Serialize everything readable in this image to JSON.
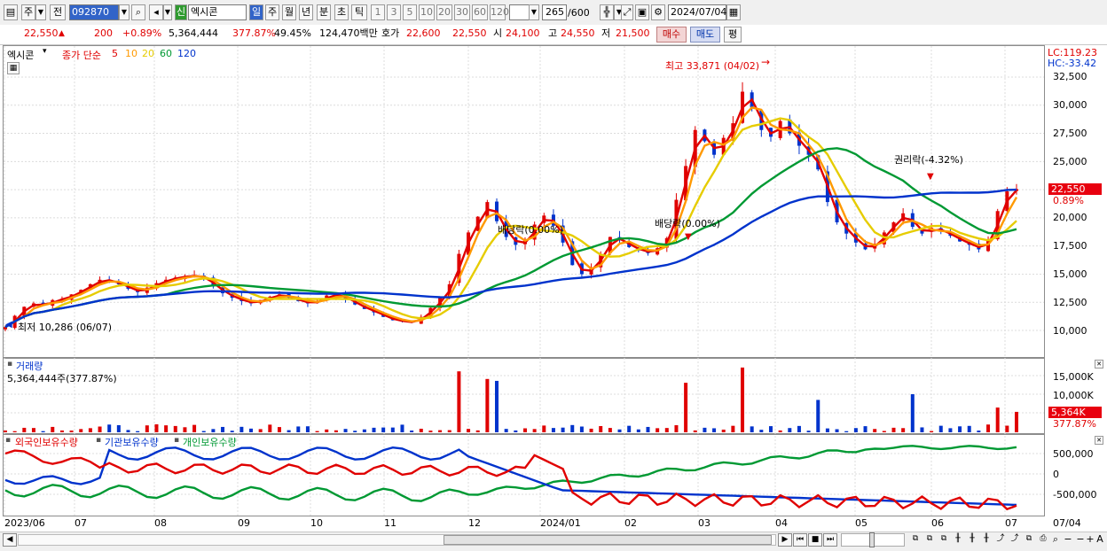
{
  "toolbar": {
    "market_mode": "주",
    "prev_label": "전",
    "code": "092870",
    "stock_badge": "신",
    "stock_name": "엑시콘",
    "periods": [
      "일",
      "주",
      "월",
      "년",
      "분",
      "초",
      "틱"
    ],
    "intervals": [
      "1",
      "3",
      "5",
      "10",
      "20",
      "30",
      "60",
      "120"
    ],
    "count": "265",
    "count_total": "/600",
    "date": "2024/07/04"
  },
  "infobar": {
    "price": "22,550",
    "change": "200",
    "change_pct": "+0.89%",
    "volume": "5,364,444",
    "volume_ratio": "377.87%",
    "turnover": "49.45%",
    "amount": "124,470백만",
    "quote_label": "호가",
    "ask": "22,600",
    "bid": "22,550",
    "open_label": "시",
    "open": "24,100",
    "high_label": "고",
    "high": "24,550",
    "low_label": "저",
    "low": "21,500",
    "buy_label": "매수",
    "sell_label": "매도",
    "eval_label": "평"
  },
  "price_panel": {
    "name": "엑시콘",
    "legend_label": "종가 단순",
    "ma_periods": [
      "5",
      "10",
      "20",
      "60",
      "120"
    ],
    "ma_colors": [
      "#e00000",
      "#ff9900",
      "#e6cc00",
      "#009933",
      "#0033cc"
    ],
    "lc": "LC:119.23",
    "hc": "HC:-33.42",
    "current_price_tag": "22,550",
    "current_pct_tag": "0.89%",
    "yticks": [
      "32,500",
      "30,000",
      "27,500",
      "25,000",
      "22,500",
      "20,000",
      "17,500",
      "15,000",
      "12,500",
      "10,000"
    ],
    "high_note": "최고 33,871 (04/02)",
    "low_note": "최저 10,286 (06/07)",
    "dividend_note_1": "배당락(0.00%)",
    "dividend_note_2": "배당락(0.00%)",
    "rights_note": "권리락(-4.32%)"
  },
  "volume_panel": {
    "title": "거래량",
    "value": "5,364,444주(377.87%)",
    "yticks": [
      "15,000K",
      "10,000K",
      "5,000K"
    ],
    "current_tag": "5,364K",
    "current_pct_tag": "377.87%"
  },
  "holding_panel": {
    "series_labels": [
      "외국인보유수량",
      "기관보유수량",
      "개인보유수량"
    ],
    "series_colors": [
      "#e00000",
      "#0033cc",
      "#009933"
    ],
    "yticks": [
      "500,000",
      "0",
      "-500,000"
    ]
  },
  "x_axis": {
    "ticks": [
      "2023/06",
      "07",
      "08",
      "09",
      "10",
      "11",
      "12",
      "2024/01",
      "02",
      "03",
      "04",
      "05",
      "06",
      "07"
    ],
    "last_label": "07/04"
  },
  "chart_data": {
    "type": "candlestick",
    "price_series_close": [
      10300,
      11300,
      12100,
      12400,
      12200,
      12700,
      12800,
      13200,
      13600,
      14100,
      14500,
      14400,
      14100,
      13700,
      13400,
      13800,
      14200,
      14500,
      14700,
      14800,
      14900,
      14600,
      13900,
      13300,
      12900,
      12600,
      12400,
      12700,
      13000,
      13200,
      12900,
      12600,
      12400,
      12600,
      13100,
      13200,
      12800,
      12300,
      11900,
      11600,
      11200,
      10900,
      10800,
      10700,
      11200,
      12000,
      12900,
      14100,
      16800,
      18700,
      20100,
      21400,
      19700,
      18300,
      17600,
      18000,
      19400,
      20200,
      19300,
      17800,
      15800,
      15000,
      15600,
      16800,
      18300,
      18000,
      17400,
      17100,
      16900,
      17300,
      18200,
      21600,
      24600,
      27800,
      26800,
      25600,
      27100,
      28400,
      31200,
      29800,
      27800,
      27200,
      28600,
      27500,
      26400,
      25600,
      24300,
      21400,
      19600,
      18600,
      17800,
      17200,
      17700,
      18700,
      19600,
      20400,
      19200,
      18600,
      19100,
      18800,
      18400,
      17900,
      17600,
      17200,
      18100,
      20600,
      22350,
      22550
    ],
    "moving_averages": {
      "ma5": "red",
      "ma10": "orange",
      "ma20": "yellow",
      "ma60": "green",
      "ma120": "blue"
    },
    "volume_spikes_k": [
      16000,
      14000,
      13500,
      13000,
      17000,
      8500,
      10000,
      6500,
      5364
    ],
    "holding_foreign_range": [
      -800000,
      650000
    ],
    "holding_institution_range": [
      -800000,
      650000
    ],
    "holding_individual_range": [
      -800000,
      650000
    ]
  }
}
